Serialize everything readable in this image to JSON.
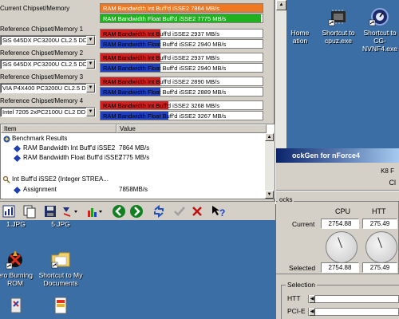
{
  "desktop": {
    "icons": [
      {
        "label": "Home\nation",
        "name": "home-icon"
      },
      {
        "label": "Shortcut to\ncpuz.exe",
        "name": "cpuz-shortcut-icon"
      },
      {
        "label": "Shortcut to\nCG-NVNF4.exe",
        "name": "clockgen-shortcut-icon"
      },
      {
        "label": "1.JPG",
        "name": "jpg-file-icon"
      },
      {
        "label": "5.JPG",
        "name": "jpg-file-icon"
      },
      {
        "label": "ero Burning\nROM",
        "name": "nero-icon"
      },
      {
        "label": "Shortcut to My\nDocuments",
        "name": "my-documents-icon"
      }
    ]
  },
  "bench": {
    "current_label": "Current Chipset/Memory",
    "current_bars": [
      {
        "text": "RAM Bandwidth Int Buff'd iSSE2 7864 MB/s",
        "fill": 1.0,
        "color": "#f07820"
      },
      {
        "text": "RAM Bandwidth Float Buff'd iSSE2 7775 MB/s",
        "fill": 0.99,
        "color": "#20b020"
      }
    ],
    "refs": [
      {
        "label": "Reference Chipset/Memory 1",
        "select": "SiS 645DX PC3200U CL2.5 DD",
        "bars": [
          {
            "text": "RAM Bandwidth Int Buff'd iSSE2 2937 MB/s",
            "fill": 0.37,
            "color": "#d02020"
          },
          {
            "text": "RAM Bandwidth Float Buff'd iSSE2 2940 MB/s",
            "fill": 0.37,
            "color": "#2040c0"
          }
        ]
      },
      {
        "label": "Reference Chipset/Memory 2",
        "select": "SiS 645DX PC3200U CL2.5 DD",
        "bars": [
          {
            "text": "RAM Bandwidth Int Buff'd iSSE2 2937 MB/s",
            "fill": 0.37,
            "color": "#d02020"
          },
          {
            "text": "RAM Bandwidth Float Buff'd iSSE2 2940 MB/s",
            "fill": 0.37,
            "color": "#2040c0"
          }
        ]
      },
      {
        "label": "Reference Chipset/Memory 3",
        "select": "VIA P4X400 PC3200U CL2.5 DD",
        "bars": [
          {
            "text": "RAM Bandwidth Int Buff'd iSSE2 2890 MB/s",
            "fill": 0.37,
            "color": "#d02020"
          },
          {
            "text": "RAM Bandwidth Float Buff'd iSSE2 2889 MB/s",
            "fill": 0.37,
            "color": "#2040c0"
          }
        ]
      },
      {
        "label": "Reference Chipset/Memory 4",
        "select": "Intel 7205 2xPC2100U CL2 DD",
        "bars": [
          {
            "text": "RAM Bandwidth Int Buff'd iSSE2 3268 MB/s",
            "fill": 0.42,
            "color": "#d02020"
          },
          {
            "text": "RAM Bandwidth Float Buff'd iSSE2 3267 MB/s",
            "fill": 0.42,
            "color": "#2040c0"
          }
        ]
      }
    ],
    "results": {
      "col_item": "Item",
      "col_value": "Value",
      "rows": [
        {
          "item": "Benchmark Results",
          "value": "",
          "indent": 0,
          "icon": "benchmark-icon"
        },
        {
          "item": "RAM Bandwidth Int Buff'd iSSE2",
          "value": "7864 MB/s",
          "indent": 1,
          "icon": "result-diamond-icon"
        },
        {
          "item": "RAM Bandwidth Float Buff'd iSSE2",
          "value": "7775 MB/s",
          "indent": 1,
          "icon": "result-diamond-icon"
        },
        {
          "item": "Int Buff'd iSSE2 (Integer STREA...",
          "value": "",
          "indent": 0,
          "icon": "key-icon"
        },
        {
          "item": "Assignment",
          "value": "7858MB/s",
          "indent": 1,
          "icon": "result-diamond-icon"
        }
      ]
    }
  },
  "clockgen": {
    "title": "ockGen for nForce4",
    "k8_label": "K8 F",
    "cl_label": "Cl",
    "group_clocks": "ocks",
    "col_cpu": "CPU",
    "col_htt": "HTT",
    "current_label": "Current",
    "selected_label": "Selected",
    "cpu_current": "2754.88",
    "htt_current": "275.49",
    "cpu_selected": "2754.88",
    "htt_selected": "275.49",
    "selection_label": "Selection",
    "htt_label": "HTT",
    "pcie_label": "PCI-E"
  }
}
